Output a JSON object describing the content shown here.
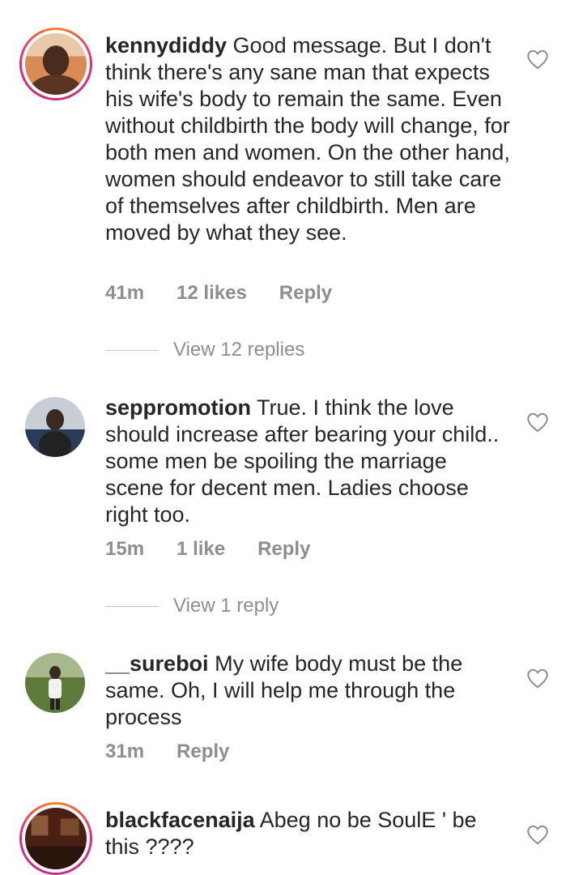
{
  "comments": [
    {
      "username": "kennydiddy",
      "text": "Good message. But I don't think there's any sane man that expects his wife's body to remain the same. Even without childbirth the body will change, for both men and women. On the other hand, women should endeavor to still take care of themselves after childbirth. Men are moved by what they see.",
      "time": "41m",
      "likes": "12 likes",
      "reply": "Reply",
      "view_replies": "View 12 replies"
    },
    {
      "username": "seppromotion",
      "text": "True. I think the love should increase after bearing your child.. some men be spoiling the marriage scene for decent men. Ladies choose right too.",
      "time": "15m",
      "likes": "1 like",
      "reply": "Reply",
      "view_replies": "View 1 reply"
    },
    {
      "username": "__sureboi",
      "text": "My wife body must be the same. Oh, I will help me through the process",
      "time": "31m",
      "reply": "Reply"
    },
    {
      "username": "blackfacenaija",
      "text": "Abeg no be SoulE ' be this ????"
    }
  ],
  "icons": {
    "like": "heart-outline-icon"
  }
}
